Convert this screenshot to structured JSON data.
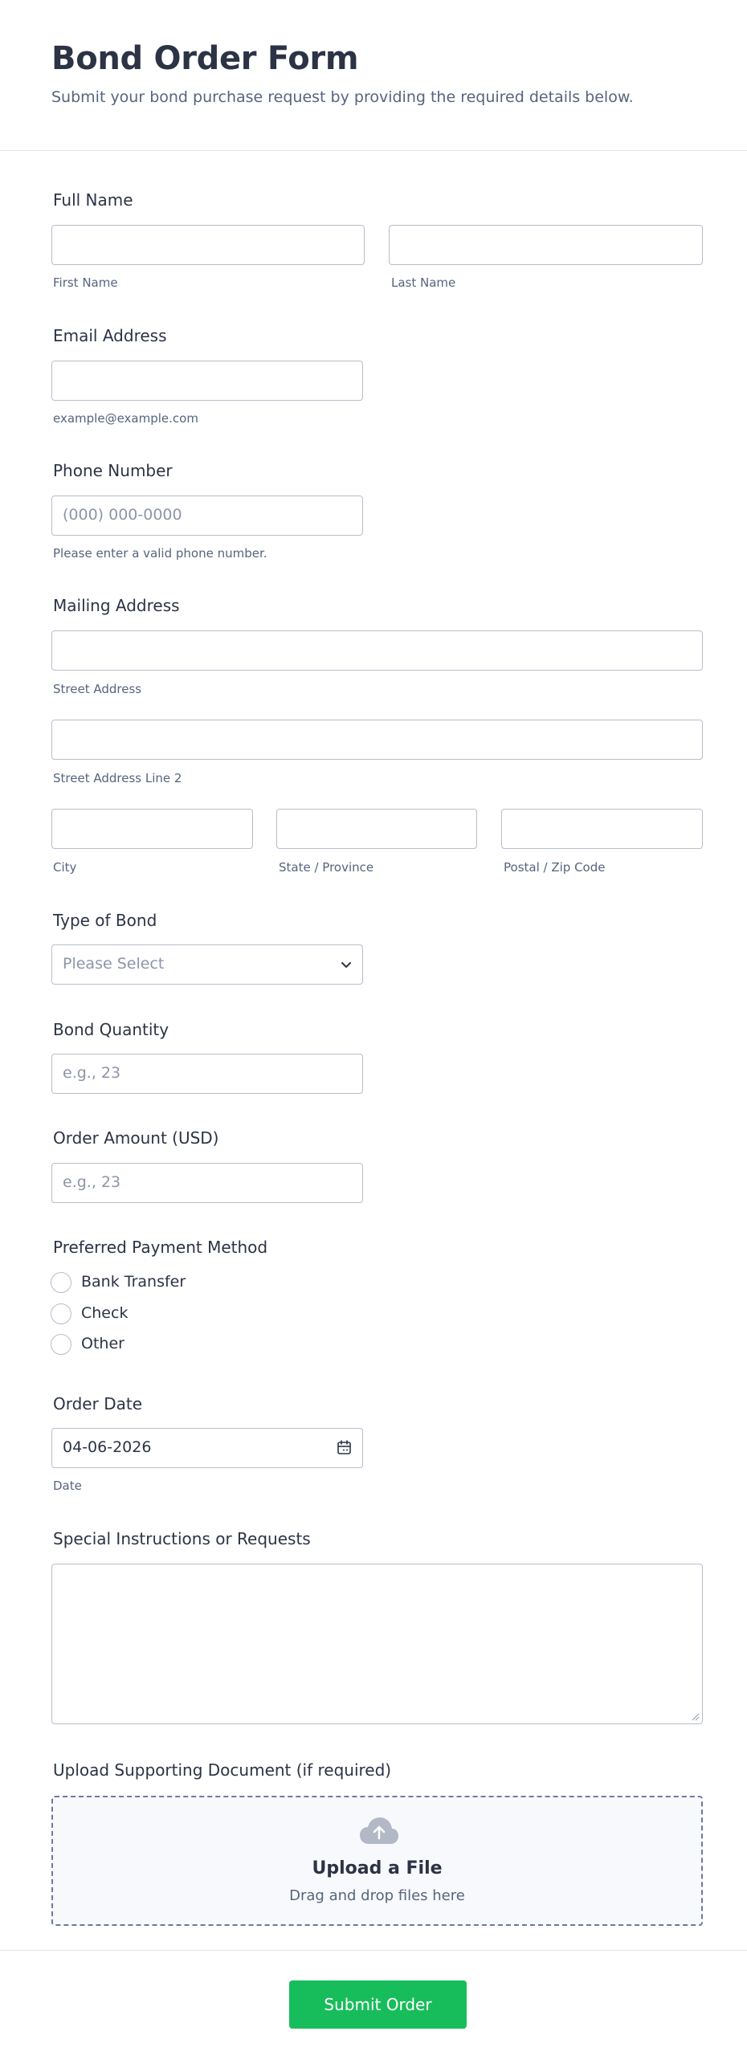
{
  "header": {
    "title": "Bond Order Form",
    "subtitle": "Submit your bond purchase request by providing the required details below."
  },
  "fields": {
    "full_name": {
      "label": "Full Name",
      "first_sub": "First Name",
      "last_sub": "Last Name",
      "first_value": "",
      "last_value": ""
    },
    "email": {
      "label": "Email Address",
      "sub": "example@example.com",
      "value": ""
    },
    "phone": {
      "label": "Phone Number",
      "placeholder": "(000) 000-0000",
      "sub": "Please enter a valid phone number."
    },
    "address": {
      "label": "Mailing Address",
      "street_sub": "Street Address",
      "street2_sub": "Street Address Line 2",
      "city_sub": "City",
      "state_sub": "State / Province",
      "zip_sub": "Postal / Zip Code"
    },
    "bond_type": {
      "label": "Type of Bond",
      "selected": "Please Select"
    },
    "bond_quantity": {
      "label": "Bond Quantity",
      "placeholder": "e.g., 23"
    },
    "order_amount": {
      "label": "Order Amount (USD)",
      "placeholder": "e.g., 23"
    },
    "payment_method": {
      "label": "Preferred Payment Method",
      "options": [
        "Bank Transfer",
        "Check",
        "Other"
      ]
    },
    "order_date": {
      "label": "Order Date",
      "value": "04-06-2026",
      "sub": "Date"
    },
    "special_instructions": {
      "label": "Special Instructions or Requests",
      "value": ""
    },
    "upload": {
      "label": "Upload Supporting Document (if required)",
      "title": "Upload a File",
      "sub": "Drag and drop files here"
    }
  },
  "submit": {
    "label": "Submit Order"
  },
  "colors": {
    "accent": "#18bd5b",
    "text": "#2c3345",
    "muted": "#57647e",
    "border": "#b8bdc9"
  },
  "icons": [
    "chevron-down-icon",
    "calendar-icon",
    "resize-handle-icon",
    "cloud-upload-icon"
  ]
}
